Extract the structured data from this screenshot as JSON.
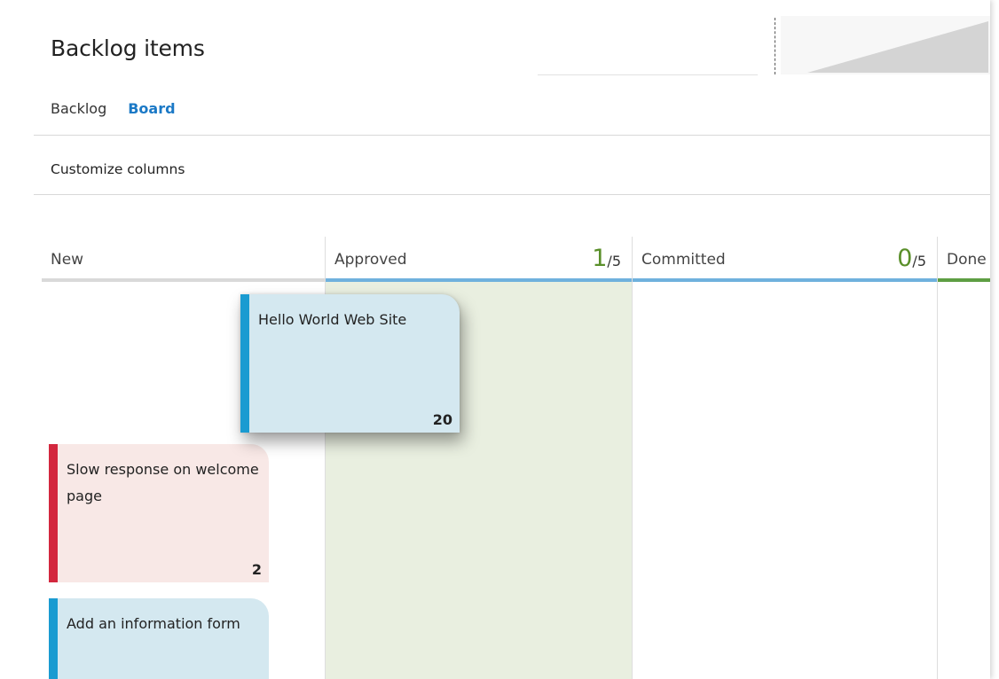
{
  "page": {
    "title": "Backlog items",
    "tabs": [
      {
        "label": "Backlog",
        "active": false
      },
      {
        "label": "Board",
        "active": true
      }
    ],
    "toolbar": {
      "customize_label": "Customize columns"
    }
  },
  "board": {
    "columns": [
      {
        "name": "New",
        "bar_color": "#d9d9d9"
      },
      {
        "name": "Approved",
        "wip_current": "1",
        "wip_limit": "/5",
        "bar_color": "#6fb1dd"
      },
      {
        "name": "Committed",
        "wip_current": "0",
        "wip_limit": "/5",
        "bar_color": "#6fb1dd"
      },
      {
        "name": "Done",
        "bar_color": "#5e9e43"
      }
    ],
    "cards": [
      {
        "title": "Hello World Web Site",
        "effort": "20",
        "color": "#1a9bd1",
        "state": "dragging"
      },
      {
        "title": "Slow response on welcome page",
        "effort": "2",
        "color": "#d3273e"
      },
      {
        "title": "Add an information form",
        "effort": "",
        "color": "#1a9bd1"
      }
    ]
  },
  "colors": {
    "accent": "#1b79c6",
    "wip_count": "#5a8f2a",
    "approved_lane_bg": "#e9efe0"
  }
}
